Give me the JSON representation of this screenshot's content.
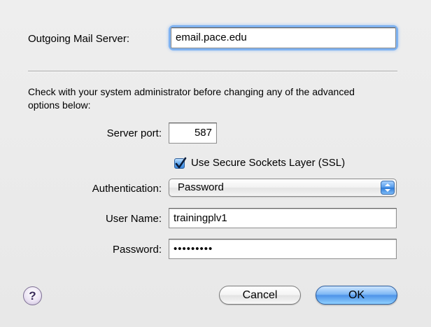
{
  "smtp": {
    "outgoing_label": "Outgoing Mail Server:",
    "outgoing_value": "email.pace.edu",
    "notice": "Check with your system administrator before changing any of the advanced options below:",
    "port_label": "Server port:",
    "port_value": "587",
    "ssl_label": "Use Secure Sockets Layer (SSL)",
    "ssl_checked": true,
    "auth_label": "Authentication:",
    "auth_value": "Password",
    "username_label": "User Name:",
    "username_value": "trainingplv1",
    "password_label": "Password:",
    "password_value": "•••••••••"
  },
  "buttons": {
    "help": "?",
    "cancel": "Cancel",
    "ok": "OK"
  },
  "colors": {
    "background": "#ececec",
    "focus_ring": "#7fb2f0",
    "accent": "#4e93e8"
  },
  "icons": {
    "check": "check-icon",
    "help": "help-icon",
    "popup_arrows": "popup-arrows-icon"
  }
}
